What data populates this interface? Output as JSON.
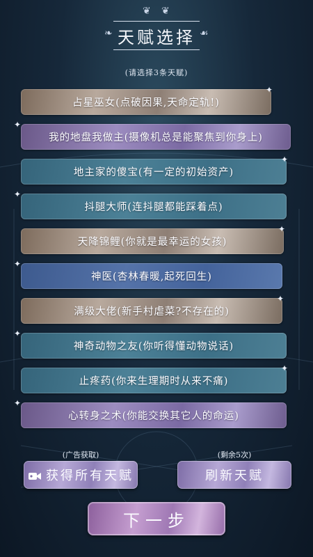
{
  "header": {
    "title": "天赋选择",
    "subtitle": "(请选择3条天赋)"
  },
  "talents": [
    {
      "label": "占星巫女(点破因果,天命定轨!)",
      "style": "gold"
    },
    {
      "label": "我的地盘我做主(摄像机总是能聚焦到你身上)",
      "style": "purple"
    },
    {
      "label": "地主家的傻宝(有一定的初始资产)",
      "style": "teal"
    },
    {
      "label": "抖腿大师(连抖腿都能踩着点)",
      "style": "teal"
    },
    {
      "label": "天降锦鲤(你就是最幸运的女孩)",
      "style": "gold"
    },
    {
      "label": "神医(杏林春暖,起死回生)",
      "style": "blue"
    },
    {
      "label": "满级大佬(新手村虐菜?不存在的)",
      "style": "gold"
    },
    {
      "label": "神奇动物之友(你听得懂动物说话)",
      "style": "teal"
    },
    {
      "label": "止疼药(你来生理期时从来不痛)",
      "style": "teal"
    },
    {
      "label": "心转身之术(你能交换其它人的命运)",
      "style": "purple"
    }
  ],
  "footer": {
    "ad_label": "(广告获取)",
    "get_all_label": "获得所有天赋",
    "remaining_label": "(剩余5次)",
    "refresh_label": "刷新天赋",
    "next_label": "下一步"
  },
  "icons": {
    "camera": "video-camera-icon",
    "sparkle": "sparkle-icon",
    "ornament": "scroll-ornament-icon"
  }
}
